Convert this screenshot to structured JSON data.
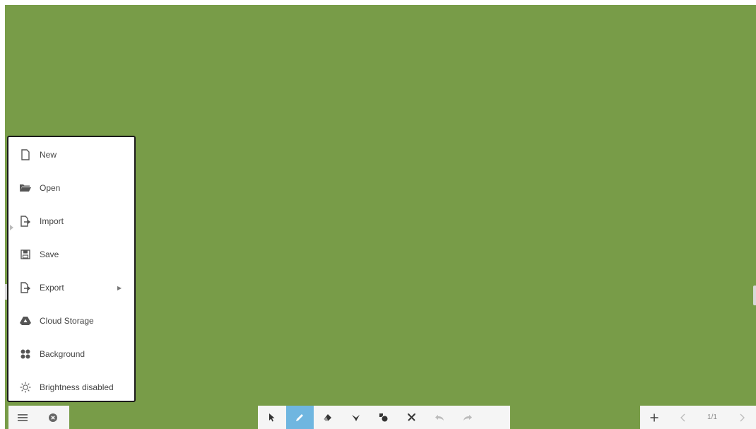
{
  "menu": {
    "items": [
      {
        "label": "New",
        "icon": "new-file-icon"
      },
      {
        "label": "Open",
        "icon": "folder-open-icon"
      },
      {
        "label": "Import",
        "icon": "import-icon"
      },
      {
        "label": "Save",
        "icon": "save-icon"
      },
      {
        "label": "Export",
        "icon": "export-icon",
        "submenu": true
      },
      {
        "label": "Cloud Storage",
        "icon": "cloud-drive-icon"
      },
      {
        "label": "Background",
        "icon": "background-icon"
      },
      {
        "label": "Brightness disabled",
        "icon": "brightness-icon"
      }
    ]
  },
  "bottom_left": {
    "menu_icon": "hamburger-menu-icon",
    "close_icon": "close-circle-icon"
  },
  "toolbar": {
    "tools": [
      "select-icon",
      "pen-icon",
      "eraser-icon",
      "lasso-icon",
      "shapes-icon",
      "clear-icon",
      "undo-icon",
      "redo-icon"
    ],
    "active_tool": "pen"
  },
  "pagination": {
    "page_indicator": "1/1",
    "add_page_icon": "plus-icon",
    "prev_icon": "chevron-left-icon",
    "next_icon": "chevron-right-icon"
  },
  "colors": {
    "board": "#789c48",
    "active_tool": "#6fb6e0",
    "toolbar_bg": "#f5f5f5"
  }
}
